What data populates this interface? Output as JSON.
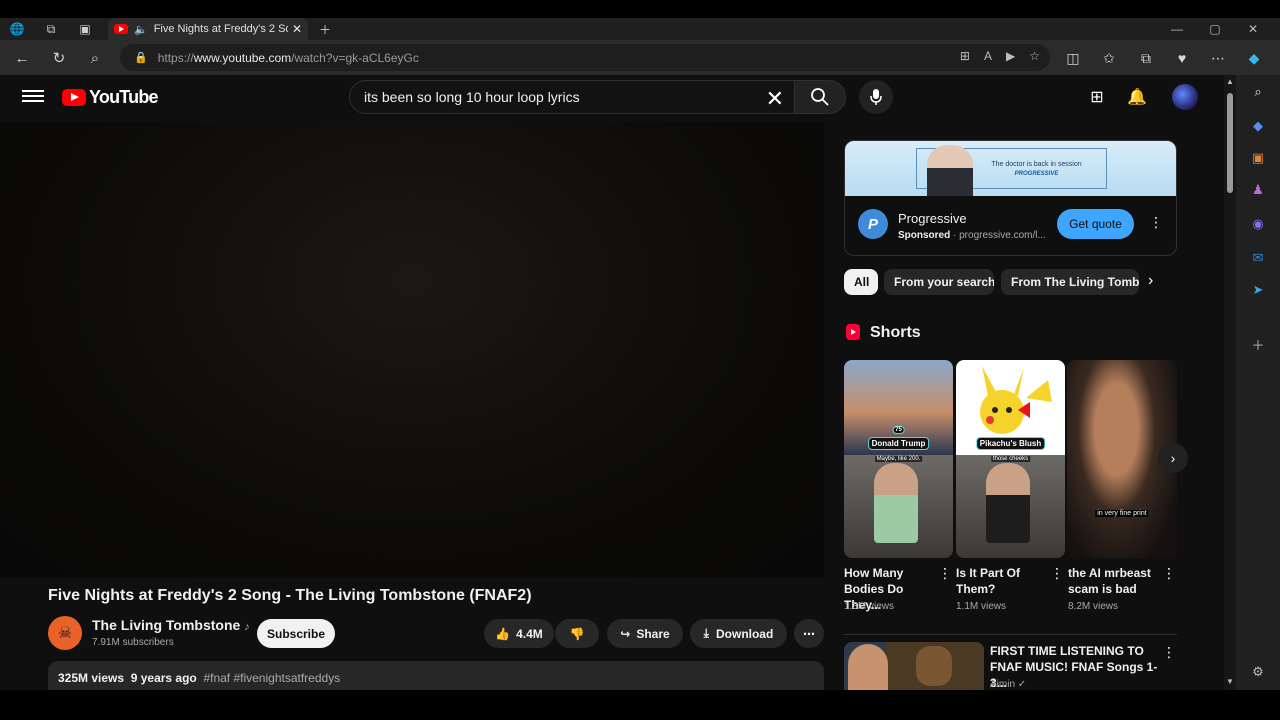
{
  "browser": {
    "tab_title": "Five Nights at Freddy's 2 So",
    "url_prefix": "https://",
    "url_host": "www.youtube.com",
    "url_path": "/watch?v=gk-aCL6eyGc"
  },
  "youtube": {
    "logo_text": "YouTube",
    "search_value": "its been so long 10 hour loop lyrics"
  },
  "video": {
    "title": "Five Nights at Freddy's 2 Song - The Living Tombstone (FNAF2)",
    "channel": "The Living Tombstone",
    "music_note": "♪",
    "subscribers": "7.91M subscribers",
    "subscribe_label": "Subscribe",
    "likes": "4.4M",
    "share_label": "Share",
    "download_label": "Download",
    "views": "325M views",
    "age": "9 years ago",
    "tags": "#fnaf #fivenightsatfreddys"
  },
  "ad": {
    "banner_line1": "The doctor is back in session",
    "banner_line2": "PROGRESSIVE",
    "logo_letter": "P",
    "name": "Progressive",
    "sponsored": "Sponsored",
    "domain": " · progressive.com/l...",
    "cta": "Get quote"
  },
  "chips": [
    "All",
    "From your search",
    "From The Living Tombs"
  ],
  "shorts": {
    "heading": "Shorts",
    "items": [
      {
        "title": "How Many Bodies Do They...",
        "views": "1.3M views",
        "caption": "Donald Trump",
        "small": "Maybe, like 200.",
        "badge": "75"
      },
      {
        "title": "Is It Part Of Them?",
        "views": "1.1M views",
        "caption": "Pikachu's Blush",
        "small": "those cheeks"
      },
      {
        "title": "the AI mrbeast scam is bad",
        "views": "8.2M views",
        "caption": "in very fine print"
      }
    ]
  },
  "recommended": {
    "title": "FIRST TIME LISTENING TO FNAF MUSIC! FNAF Songs 1-3...",
    "channel": "Aimin ✓"
  },
  "colors": {
    "page_bg": "#0f0f0f",
    "yt_red": "#ff0000",
    "accent_blue": "#3ea6ff",
    "chip_bg": "#272727"
  }
}
